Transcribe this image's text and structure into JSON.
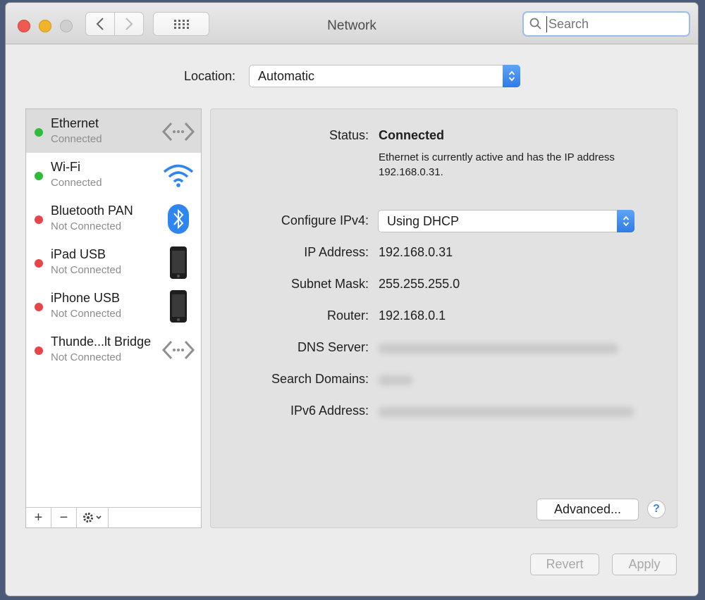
{
  "window": {
    "title": "Network",
    "search_placeholder": "Search"
  },
  "location": {
    "label": "Location:",
    "value": "Automatic"
  },
  "services": [
    {
      "name": "Ethernet",
      "status": "Connected",
      "dot": "#2ebd3b",
      "icon": "ethernet-icon"
    },
    {
      "name": "Wi-Fi",
      "status": "Connected",
      "dot": "#2ebd3b",
      "icon": "wifi-icon"
    },
    {
      "name": "Bluetooth PAN",
      "status": "Not Connected",
      "dot": "#e8454a",
      "icon": "bluetooth-icon"
    },
    {
      "name": "iPad USB",
      "status": "Not Connected",
      "dot": "#e8454a",
      "icon": "ipad-icon"
    },
    {
      "name": "iPhone USB",
      "status": "Not Connected",
      "dot": "#e8454a",
      "icon": "iphone-icon"
    },
    {
      "name": "Thunde...lt Bridge",
      "status": "Not Connected",
      "dot": "#e8454a",
      "icon": "thunderbolt-bridge-icon"
    }
  ],
  "sidebar_tools": {
    "add": "+",
    "remove": "−"
  },
  "detail": {
    "status_label": "Status:",
    "status_value": "Connected",
    "status_desc": "Ethernet is currently active and has the IP address 192.168.0.31.",
    "configure_label": "Configure IPv4:",
    "configure_value": "Using DHCP",
    "ip_label": "IP Address:",
    "ip_value": "192.168.0.31",
    "subnet_label": "Subnet Mask:",
    "subnet_value": "255.255.255.0",
    "router_label": "Router:",
    "router_value": "192.168.0.1",
    "dns_label": "DNS Server:",
    "search_domains_label": "Search Domains:",
    "ipv6_label": "IPv6 Address:",
    "advanced_label": "Advanced...",
    "help_label": "?"
  },
  "footer": {
    "revert_label": "Revert",
    "apply_label": "Apply"
  },
  "colors": {
    "connected": "#2ebd3b",
    "not_connected": "#e8454a",
    "accent": "#2f7be6"
  }
}
